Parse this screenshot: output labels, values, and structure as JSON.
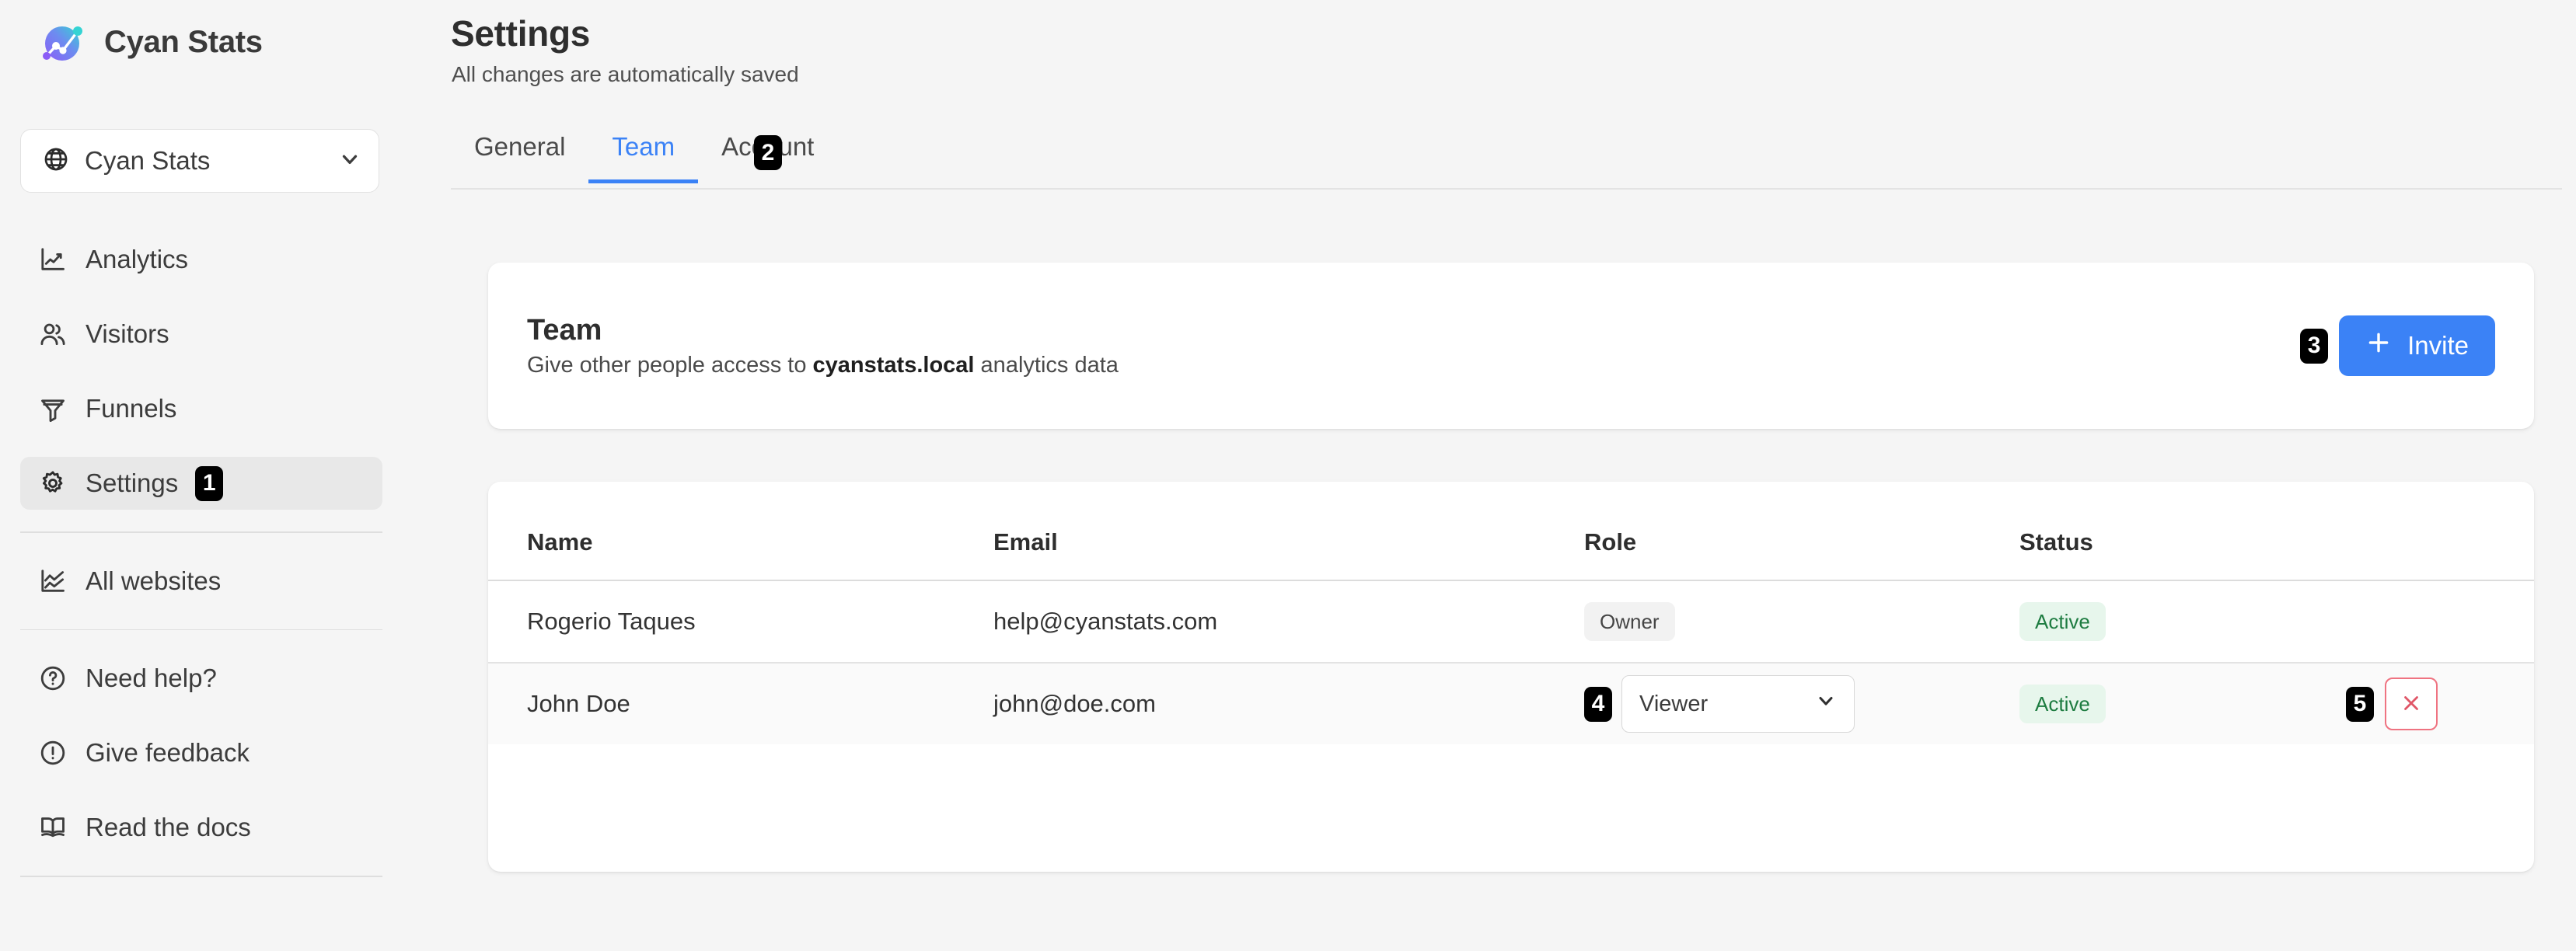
{
  "brand": {
    "name": "Cyan Stats",
    "logo_icon": "cyan-stats-logo"
  },
  "site_selector": {
    "value": "Cyan Stats",
    "globe_icon": "globe-icon",
    "chevron_icon": "chevron-down-icon"
  },
  "sidebar": {
    "primary_items": [
      {
        "label": "Analytics",
        "icon": "line-chart-icon",
        "active": false,
        "marker": null
      },
      {
        "label": "Visitors",
        "icon": "users-icon",
        "active": false,
        "marker": null
      },
      {
        "label": "Funnels",
        "icon": "funnel-icon",
        "active": false,
        "marker": null
      },
      {
        "label": "Settings",
        "icon": "gear-icon",
        "active": true,
        "marker": "1"
      }
    ],
    "secondary_items": [
      {
        "label": "All websites",
        "icon": "area-chart-icon"
      }
    ],
    "footer_items": [
      {
        "label": "Need help?",
        "icon": "question-circle-icon"
      },
      {
        "label": "Give feedback",
        "icon": "exclamation-circle-icon"
      },
      {
        "label": "Read the docs",
        "icon": "book-open-icon"
      }
    ]
  },
  "header": {
    "title": "Settings",
    "subtitle": "All changes are automatically saved"
  },
  "tabs": [
    {
      "label": "General",
      "active": false
    },
    {
      "label": "Team",
      "active": true
    },
    {
      "label": "Account",
      "active": false
    }
  ],
  "tab_marker": "2",
  "team_card": {
    "title": "Team",
    "description_prefix": "Give other people access to ",
    "description_domain": "cyanstats.local",
    "description_suffix": " analytics data",
    "invite_label": "Invite",
    "invite_icon": "plus-icon",
    "invite_marker": "3"
  },
  "table": {
    "columns": [
      "Name",
      "Email",
      "Role",
      "Status",
      ""
    ],
    "rows": [
      {
        "name": "Rogerio Taques",
        "email": "help@cyanstats.com",
        "role_type": "pill",
        "role": "Owner",
        "status": "Active",
        "action": null,
        "role_marker": null,
        "action_marker": null
      },
      {
        "name": "John Doe",
        "email": "john@doe.com",
        "role_type": "select",
        "role": "Viewer",
        "status": "Active",
        "action": "remove",
        "action_icon": "close-icon",
        "role_marker": "4",
        "action_marker": "5"
      }
    ]
  },
  "colors": {
    "accent_blue": "#3b82f6",
    "status_green_text": "#1e7c41",
    "status_green_bg": "#e7f6ec",
    "danger_red": "#ef7381",
    "page_bg": "#f5f5f5",
    "card_bg": "#ffffff",
    "marker_bg": "#000000"
  }
}
